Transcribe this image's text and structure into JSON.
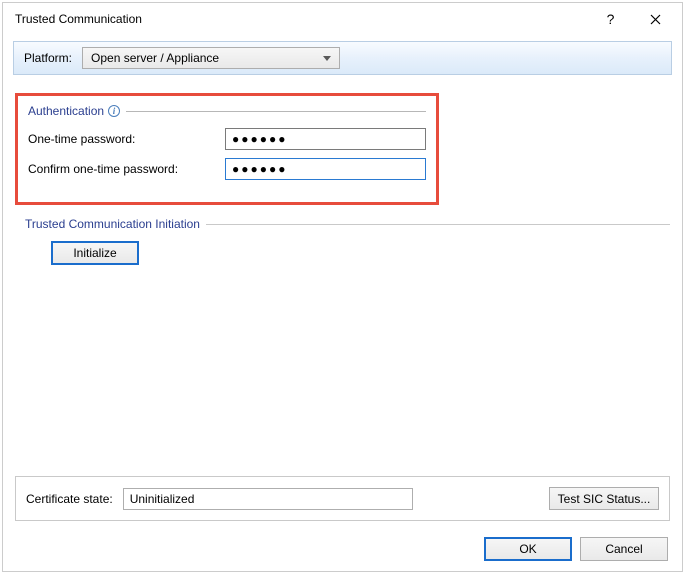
{
  "titlebar": {
    "title": "Trusted Communication",
    "help": "?",
    "close": "×"
  },
  "platform": {
    "label": "Platform:",
    "selected": "Open server / Appliance"
  },
  "auth": {
    "legend": "Authentication",
    "otp_label": "One-time password:",
    "otp_value": "●●●●●●",
    "confirm_label": "Confirm one-time password:",
    "confirm_value": "●●●●●●"
  },
  "tci": {
    "legend": "Trusted Communication Initiation",
    "initialize": "Initialize"
  },
  "cert": {
    "label": "Certificate state:",
    "value": "Uninitialized",
    "test_button": "Test SIC Status..."
  },
  "footer": {
    "ok": "OK",
    "cancel": "Cancel"
  }
}
